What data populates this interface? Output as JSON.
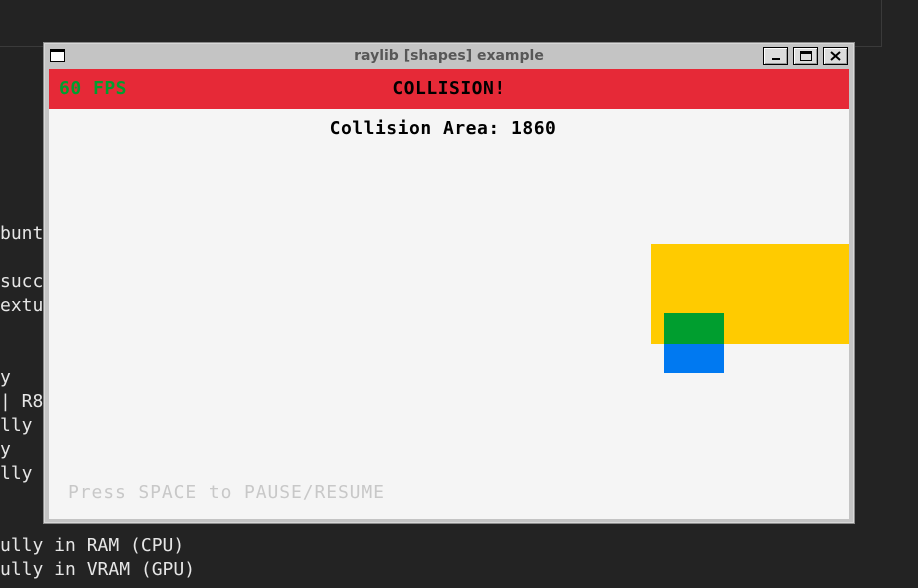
{
  "terminal": {
    "lines": [
      "bunt",
      "succ",
      "extu",
      "y",
      "| R8",
      "lly",
      "y",
      "lly",
      "ully in RAM (CPU)",
      "ully in VRAM (GPU)"
    ]
  },
  "window": {
    "title": "raylib [shapes] example",
    "controls": {
      "system_menu_icon": "window-menu-icon",
      "minimize_icon": "minimize-icon",
      "maximize_icon": "maximize-icon",
      "close_icon": "close-icon"
    }
  },
  "canvas": {
    "fps_text": "60 FPS",
    "collision_text": "COLLISION!",
    "collision_area_text": "Collision Area: 1860",
    "hint_text": "Press SPACE to PAUSE/RESUME",
    "colors": {
      "background": "#f5f5f5",
      "header_bar": "#e62937",
      "fps_text": "#009e2f",
      "static_rect": "#ffcb00",
      "moving_rect": "#0079f1",
      "overlap_rect": "#009e2f",
      "hint_text": "#c8c8c8"
    }
  }
}
